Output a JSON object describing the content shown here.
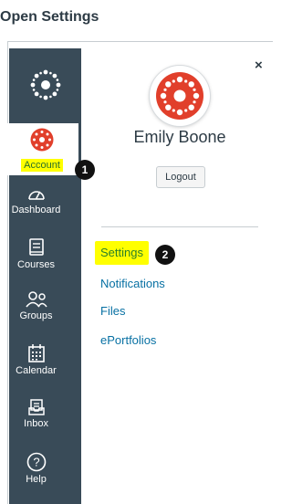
{
  "heading": "Open Settings",
  "nav": {
    "account": "Account",
    "items": [
      {
        "label": "Dashboard",
        "icon": "dashboard-icon"
      },
      {
        "label": "Courses",
        "icon": "courses-icon"
      },
      {
        "label": "Groups",
        "icon": "groups-icon"
      },
      {
        "label": "Calendar",
        "icon": "calendar-icon"
      },
      {
        "label": "Inbox",
        "icon": "inbox-icon"
      },
      {
        "label": "Help",
        "icon": "help-icon"
      }
    ]
  },
  "badges": {
    "one": "1",
    "two": "2"
  },
  "tray": {
    "close": "×",
    "user_name": "Emily Boone",
    "logout": "Logout",
    "links": {
      "settings": "Settings",
      "notifications": "Notifications",
      "files": "Files",
      "eportfolios": "ePortfolios"
    }
  },
  "colors": {
    "nav_bg": "#394b58",
    "link": "#0770a3",
    "highlight": "#ffff00",
    "canvas_red": "#e13f2b"
  }
}
